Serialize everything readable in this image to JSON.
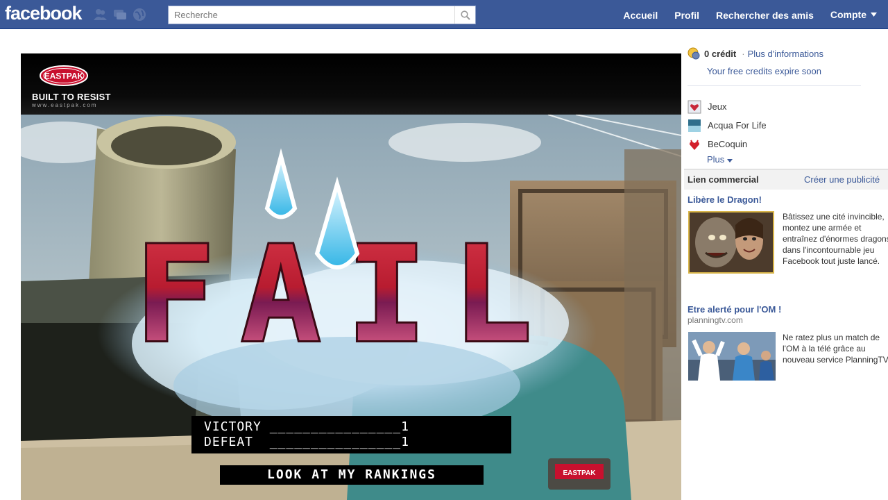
{
  "header": {
    "logo": "facebook",
    "search_placeholder": "Recherche",
    "nav": [
      "Accueil",
      "Profil",
      "Rechercher des amis",
      "Compte"
    ]
  },
  "game": {
    "brand_name": "EASTPAK",
    "brand_tagline": "BUILT TO RESIST",
    "brand_url": "www.eastpak.com",
    "fail_text": "FAIL",
    "victory_row": "VICTORY ________________1",
    "defeat_row": "DEFEAT  ________________1",
    "rankings_button": "LOOK AT MY RANKINGS",
    "backpack_label": "EASTPAK"
  },
  "sidebar": {
    "credits": "0 crédit",
    "credits_link": "Plus d'informations",
    "credits_expire": "Your free credits expire soon",
    "apps": [
      "Jeux",
      "Acqua For Life",
      "BeCoquin"
    ],
    "more": "Plus",
    "ads_header": "Lien commercial",
    "create_ad": "Créer une publicité",
    "ads": [
      {
        "title": "Libère le Dragon!",
        "body": "Bâtissez une cité invincible, montez une armée et entraînez d'énormes dragons dans l'incontournable jeu Facebook tout juste lancé."
      },
      {
        "title": "Etre alerté pour l'OM !",
        "domain": "planningtv.com",
        "body": "Ne ratez plus un match de l'OM à la télé grâce au nouveau service PlanningTV."
      }
    ]
  },
  "colors": {
    "brand_blue": "#3b5998",
    "link_blue": "#3b5998",
    "fail_red": "#c8283a"
  }
}
